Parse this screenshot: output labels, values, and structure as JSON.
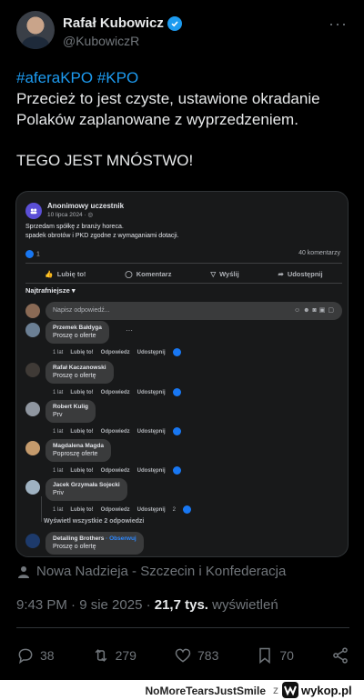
{
  "tweet": {
    "author_name": "Rafał Kubowicz",
    "handle": "@KubowiczR",
    "more": "···",
    "hashtags": "#aferaKPO #KPO",
    "text_line1": "Przecież to jest czyste, ustawione okradanie Polaków zaplanowane z wyprzedzeniem.",
    "text_line2": "TEGO JEST MNÓSTWO!",
    "location": "Nowa Nadzieja - Szczecin i Konfederacja",
    "time": "9:43 PM · 9 sie 2025 · ",
    "views_count": "21,7 tys.",
    "views_label": " wyświetleń",
    "replies": "38",
    "retweets": "279",
    "likes": "783",
    "bookmarks": "70"
  },
  "fb": {
    "author": "Anonimowy uczestnik",
    "date": "10 lipca 2024 · ",
    "text1": "Sprzedam spółkę z branży horeca.",
    "text2": "spadek obrotów i PKD zgodne z wymaganiami dotacji.",
    "likes": "1",
    "comments": "40 komentarzy",
    "action_like": "Lubię to!",
    "action_comment": "Komentarz",
    "action_send": "Wyślij",
    "action_share": "Udostępnij",
    "sort": "Najtrafniejsze",
    "reply_placeholder": "Napisz odpowiedź...",
    "view_all": "Wyświetl wszystkie 2 odpowiedzi",
    "comments_list": [
      {
        "author": "Przemek Bałdyga",
        "text": "Proszę o oferte",
        "time": "1 lat",
        "like": "Lubię to!",
        "reply": "Odpowiedz",
        "share": "Udostępnij"
      },
      {
        "author": "Rafał Kaczanowski",
        "text": "Proszę o ofertę",
        "time": "1 lat",
        "like": "Lubię to!",
        "reply": "Odpowiedz",
        "share": "Udostępnij"
      },
      {
        "author": "Robert Kulig",
        "text": "Prv",
        "time": "1 lat",
        "like": "Lubię to!",
        "reply": "Odpowiedz",
        "share": "Udostępnij"
      },
      {
        "author": "Magdalena Magda",
        "text": "Poproszę oferte",
        "time": "1 lat",
        "like": "Lubię to!",
        "reply": "Odpowiedz",
        "share": "Udostępnij"
      },
      {
        "author": "Jacek Grzymała Sojecki",
        "text": "Priv",
        "time": "1 lat",
        "like": "Lubię to!",
        "reply": "Odpowiedz",
        "share": "Udostępnij",
        "count": "2"
      },
      {
        "author": "Detailing Brothers",
        "follow": " · Obserwuj",
        "text": "Proszę o ofertę"
      }
    ]
  },
  "footer": {
    "user": "NoMoreTearsJustSmile",
    "separator": "z",
    "site": "wykop.pl"
  },
  "colors": {
    "accent": "#1d9bf0",
    "fb_blue": "#1877f2",
    "muted": "#71767b"
  }
}
